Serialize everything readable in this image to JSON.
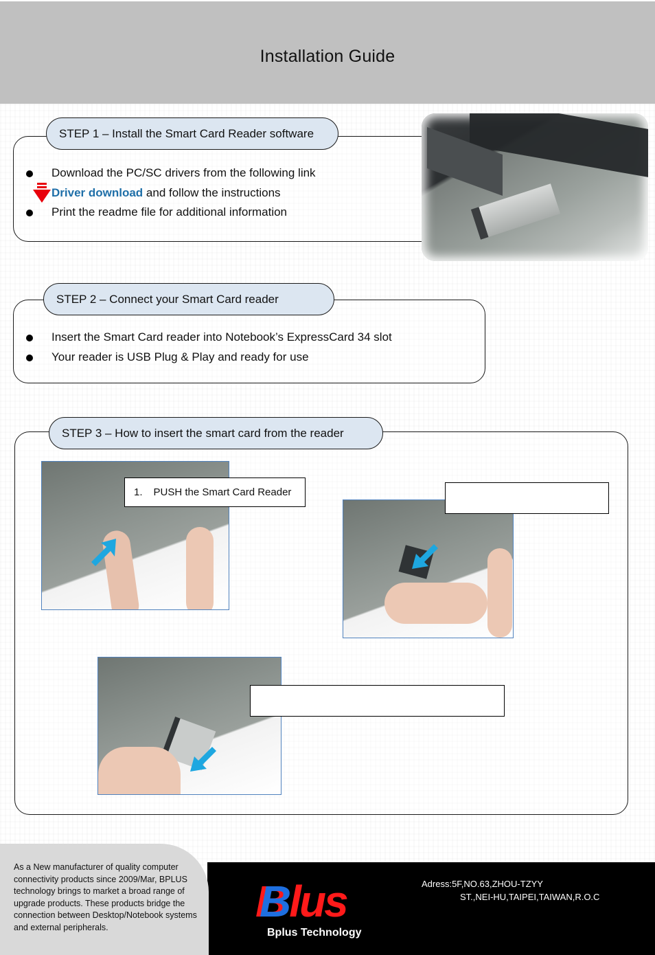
{
  "header": {
    "title": "Installation Guide"
  },
  "step1": {
    "title": "STEP 1 – Install the Smart Card Reader software",
    "bullets": [
      "Download the PC/SC drivers from the following link",
      "Print the readme file for additional information"
    ],
    "link_label": "Driver download",
    "link_suffix": " and follow the instructions",
    "photo_alt": "Smart card reader inserted in notebook ExpressCard slot"
  },
  "step2": {
    "title": "STEP 2 – Connect your Smart Card reader",
    "bullets": [
      "Insert the Smart Card reader into Notebook’s ExpressCard 34 slot",
      "Your reader is USB Plug & Play and ready for use"
    ]
  },
  "step3": {
    "title": "STEP 3 – How to insert the smart card from the reader",
    "callouts": [
      {
        "number": "1.",
        "text": "PUSH the Smart Card Reader"
      },
      {
        "number": "",
        "text": ""
      },
      {
        "number": "",
        "text": ""
      }
    ]
  },
  "footer": {
    "about": "As a New manufacturer of quality computer connectivity products since 2009/Mar, BPLUS technology brings to market a broad range of upgrade products. These products bridge the connection between Desktop/Notebook systems and external peripherals.",
    "logo_text_b": "B",
    "logo_text_lus": "lus",
    "logo_sub": "Bplus Technology",
    "address_line1": "Adress:5F,NO.63,ZHOU-TZYY",
    "address_line2": "ST.,NEI-HU,TAIPEI,TAIWAN,R.O.C"
  },
  "colors": {
    "header_bg": "#c0c0c0",
    "pill_bg": "#dce6f1",
    "link": "#1f6fa8",
    "logo_red": "#ff1a1a",
    "logo_blue": "#1e6fe0",
    "arrow_blue": "#1ea7e0",
    "download_arrow_red": "#e8000b"
  }
}
